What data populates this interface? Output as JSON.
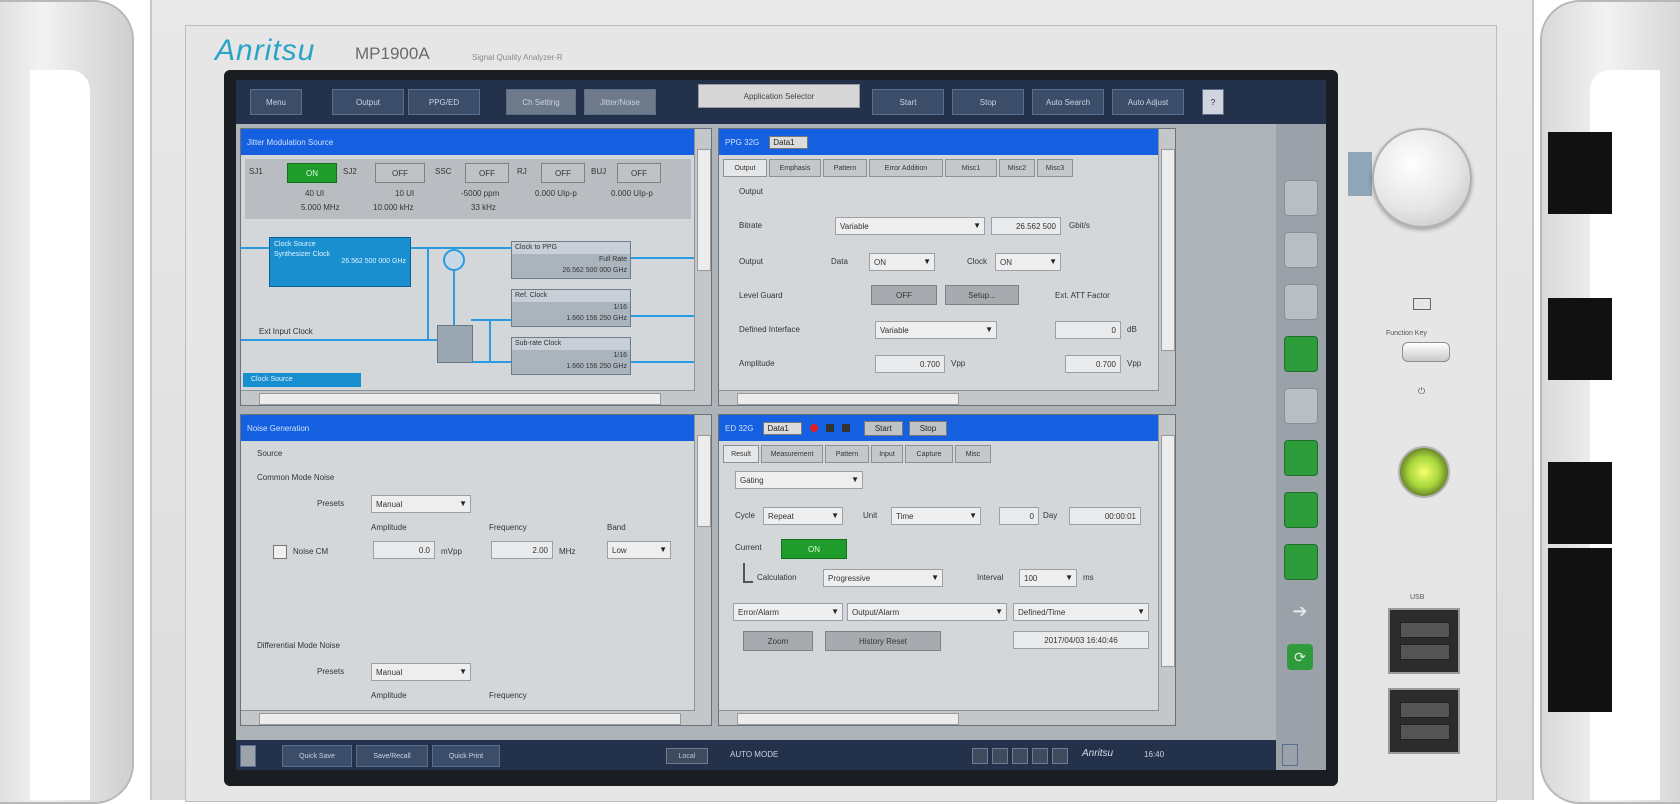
{
  "device": {
    "brand": "Anritsu",
    "model": "MP1900A",
    "subtitle": "Signal Quality Analyzer-R",
    "function_key_label": "Function Key",
    "usb_label": "USB"
  },
  "toolbar": {
    "buttons": [
      "Menu",
      "Output",
      "PPG/ED",
      "Ch Setting",
      "Jitter/Noise"
    ],
    "application_selector": "Application Selector",
    "right_buttons": [
      "Start",
      "Stop",
      "Auto Search",
      "Auto Adjust"
    ]
  },
  "panels": {
    "jitter": {
      "title": "Jitter Modulation Source",
      "items": [
        {
          "label": "SJ1",
          "state": "ON",
          "value1": "40 UI",
          "value2": "5.000 MHz"
        },
        {
          "label": "SJ2",
          "state": "OFF",
          "value1": "10 UI",
          "value2": "10.000 kHz"
        },
        {
          "label": "SSC",
          "state": "OFF",
          "value1": "-5000 ppm",
          "value2": "33 kHz"
        },
        {
          "label": "RJ",
          "state": "OFF",
          "value1": "0.000 UIp-p",
          "value2": ""
        },
        {
          "label": "BUJ",
          "state": "OFF",
          "value1": "0.000 UIp-p",
          "value2": ""
        }
      ],
      "clock_source_title": "Clock Source",
      "clock_source_lines": [
        "Synthesizer Clock",
        "26.562 500 000 GHz"
      ],
      "ext_input": "Ext Input Clock",
      "blocks": [
        {
          "title": "Clock to PPG",
          "lines": [
            "Full Rate",
            "26.562 500 000 GHz"
          ]
        },
        {
          "title": "Ref. Clock",
          "lines": [
            "1/16",
            "1.660 156 250 GHz"
          ]
        },
        {
          "title": "Sub-rate Clock",
          "lines": [
            "1/16",
            "1.660 156 250 GHz"
          ]
        }
      ],
      "bottom_tab": "Clock Source"
    },
    "ppg": {
      "title": "PPG 32G",
      "dropdown": "Data1",
      "tabs": [
        "Output",
        "Emphasis",
        "Pattern",
        "Error Addition",
        "Misc1",
        "Misc2",
        "Misc3"
      ],
      "section": "Output",
      "bitrate_label": "Bitrate",
      "bitrate_value": "Variable",
      "bitrate_field": "26.562 500",
      "bitrate_unit": "Gbit/s",
      "output_label": "Output",
      "data_label": "Data",
      "data_value": "ON",
      "clock_label": "Clock",
      "clock_value": "ON",
      "level_guard_label": "Level Guard",
      "level_guard_btn": "OFF",
      "setup_btn": "Setup...",
      "ext_att_label": "Ext. ATT Factor",
      "defined_label": "Defined Interface",
      "defined_value": "Variable",
      "att_value": "0",
      "att_unit": "dB",
      "amplitude_label": "Amplitude",
      "amplitude_value": "0.700",
      "amplitude_unit": "Vpp",
      "amplitude_value2": "0.700",
      "amplitude_unit2": "Vpp"
    },
    "noise": {
      "title": "Noise Generation",
      "section": "Source",
      "cm_label": "Common Mode Noise",
      "preset_label": "Presets",
      "preset_value": "Manual",
      "amp_label": "Amplitude",
      "freq_label": "Frequency",
      "band_label": "Band",
      "noise_checkbox_label": "Noise CM",
      "amp_value": "0.0",
      "amp_unit": "mVpp",
      "freq_value": "2.00",
      "freq_unit": "MHz",
      "band_value": "Low",
      "dm_label": "Differential Mode Noise",
      "preset_value2": "Manual",
      "amp_label2": "Amplitude",
      "freq_label2": "Frequency"
    },
    "ed": {
      "title": "ED 32G",
      "dropdown": "Data1",
      "start_btn": "Start",
      "stop_btn": "Stop",
      "tabs": [
        "Result",
        "Measurement",
        "Pattern",
        "Input",
        "Capture",
        "Misc"
      ],
      "gating": "Gating",
      "cycle_label": "Cycle",
      "cycle_value": "Repeat",
      "unit_label": "Unit",
      "unit_value": "Time",
      "time_value": "0",
      "time_unit": "Day",
      "time_value2": "00:00:01",
      "current_label": "Current",
      "current_value": "ON",
      "calc_label": "Calculation",
      "calc_value": "Progressive",
      "interval_label": "Interval",
      "interval_value": "100",
      "interval_unit": "ms",
      "sel1": "Error/Alarm",
      "sel2": "Output/Alarm",
      "sel3": "Defined/Time",
      "zoom_btn": "Zoom",
      "history_btn": "History Reset",
      "timestamp": "2017/04/03 16:40:46"
    }
  },
  "bottombar": {
    "buttons": [
      "Quick Save",
      "Save/Recall",
      "Quick Print"
    ],
    "status_left": "Local",
    "status_mid": "AUTO MODE",
    "brand": "Anritsu",
    "time": "16:40"
  }
}
